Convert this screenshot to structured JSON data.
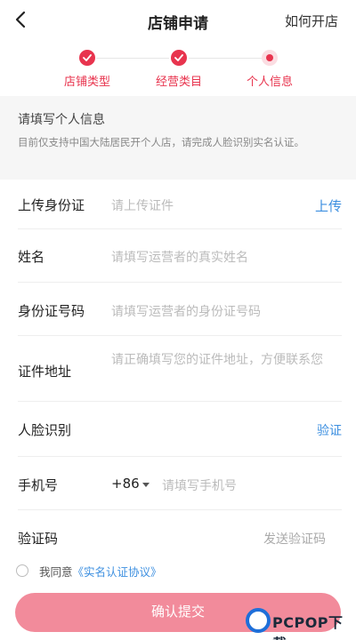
{
  "nav": {
    "title": "店铺申请",
    "help": "如何开店",
    "back_icon": "chevron-left-icon"
  },
  "steps": [
    {
      "label": "店铺类型",
      "state": "done"
    },
    {
      "label": "经营类目",
      "state": "done"
    },
    {
      "label": "个人信息",
      "state": "current"
    }
  ],
  "notice": {
    "title": "请填写个人信息",
    "text": "目前仅支持中国大陆居民开个人店，请完成人脸识别实名认证。"
  },
  "form": {
    "id_upload": {
      "label": "上传身份证",
      "placeholder": "请上传证件",
      "action": "上传"
    },
    "name": {
      "label": "姓名",
      "placeholder": "请填写运营者的真实姓名"
    },
    "id_number": {
      "label": "身份证号码",
      "placeholder": "请填写运营者的身份证号码"
    },
    "address": {
      "label": "证件地址",
      "placeholder": "请正确填写您的证件地址，方便联系您"
    },
    "face": {
      "label": "人脸识别",
      "action": "验证"
    },
    "phone": {
      "label": "手机号",
      "country_code": "+86",
      "placeholder": "请填写手机号"
    },
    "code": {
      "label": "验证码",
      "action": "发送验证码"
    }
  },
  "agreement": {
    "prefix": "我同意",
    "link": "《实名认证协议》"
  },
  "submit_label": "确认提交",
  "watermark": {
    "brand": "PCPOP下载"
  },
  "colors": {
    "accent": "#e8344e",
    "link": "#3c8fe0",
    "submit_bg": "#f28b9b"
  }
}
